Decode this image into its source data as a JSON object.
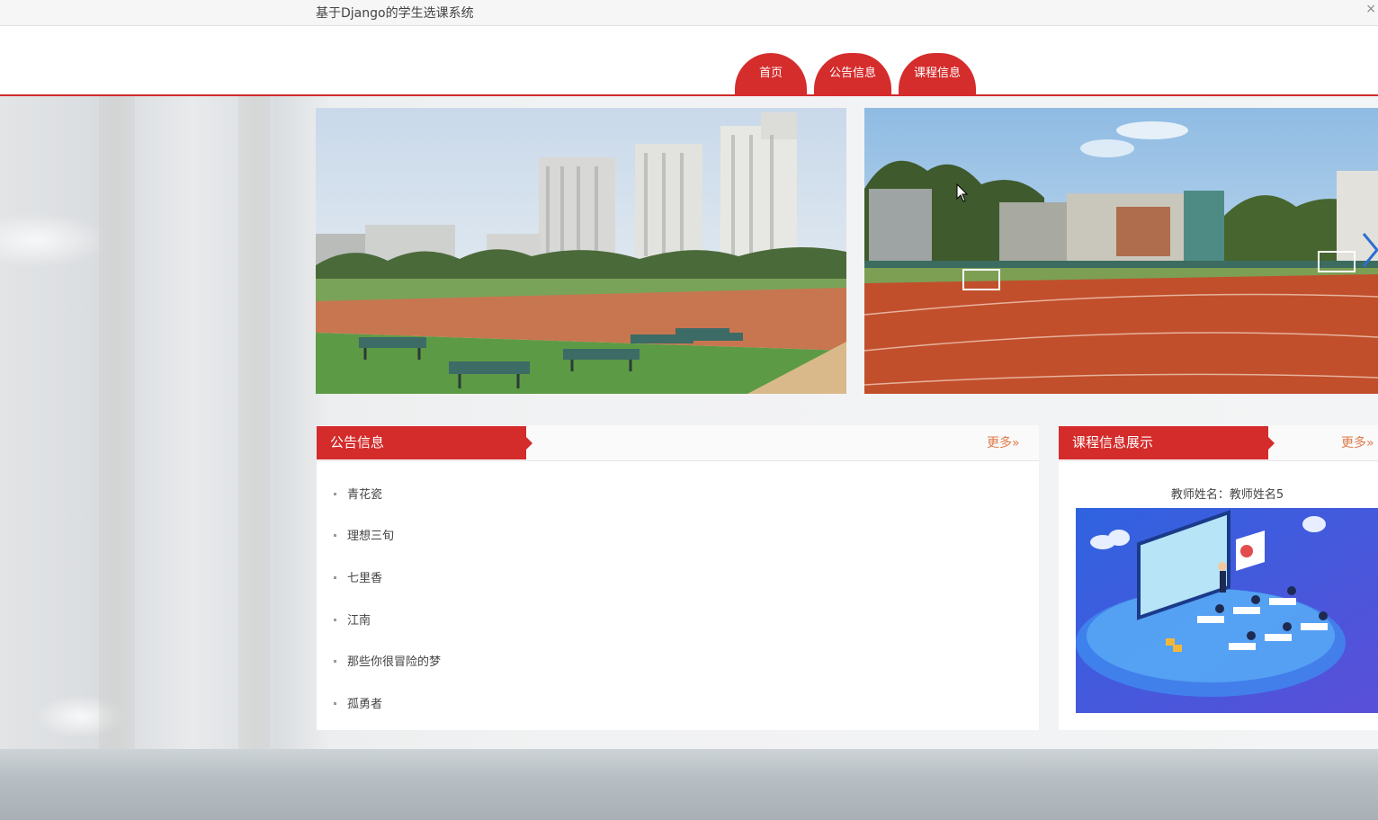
{
  "window": {
    "title": "基于Django的学生选课系统",
    "close_glyph": "×"
  },
  "nav": {
    "items": [
      {
        "label": "首页"
      },
      {
        "label": "公告信息"
      },
      {
        "label": "课程信息"
      }
    ]
  },
  "banners": [
    {
      "icon": "campus-photo-table-tennis"
    },
    {
      "icon": "campus-photo-running-track"
    }
  ],
  "notice_panel": {
    "title": "公告信息",
    "more_label": "更多»",
    "items": [
      {
        "label": "青花瓷"
      },
      {
        "label": "理想三旬"
      },
      {
        "label": "七里香"
      },
      {
        "label": "江南"
      },
      {
        "label": "那些你很冒险的梦"
      },
      {
        "label": "孤勇者"
      }
    ]
  },
  "course_panel": {
    "title": "课程信息展示",
    "more_label": "更多»",
    "teacher_label": "教师姓名：教师姓名5",
    "image_icon": "classroom-illustration"
  },
  "colors": {
    "accent": "#d42b2b",
    "more_link": "#e07a4a"
  }
}
